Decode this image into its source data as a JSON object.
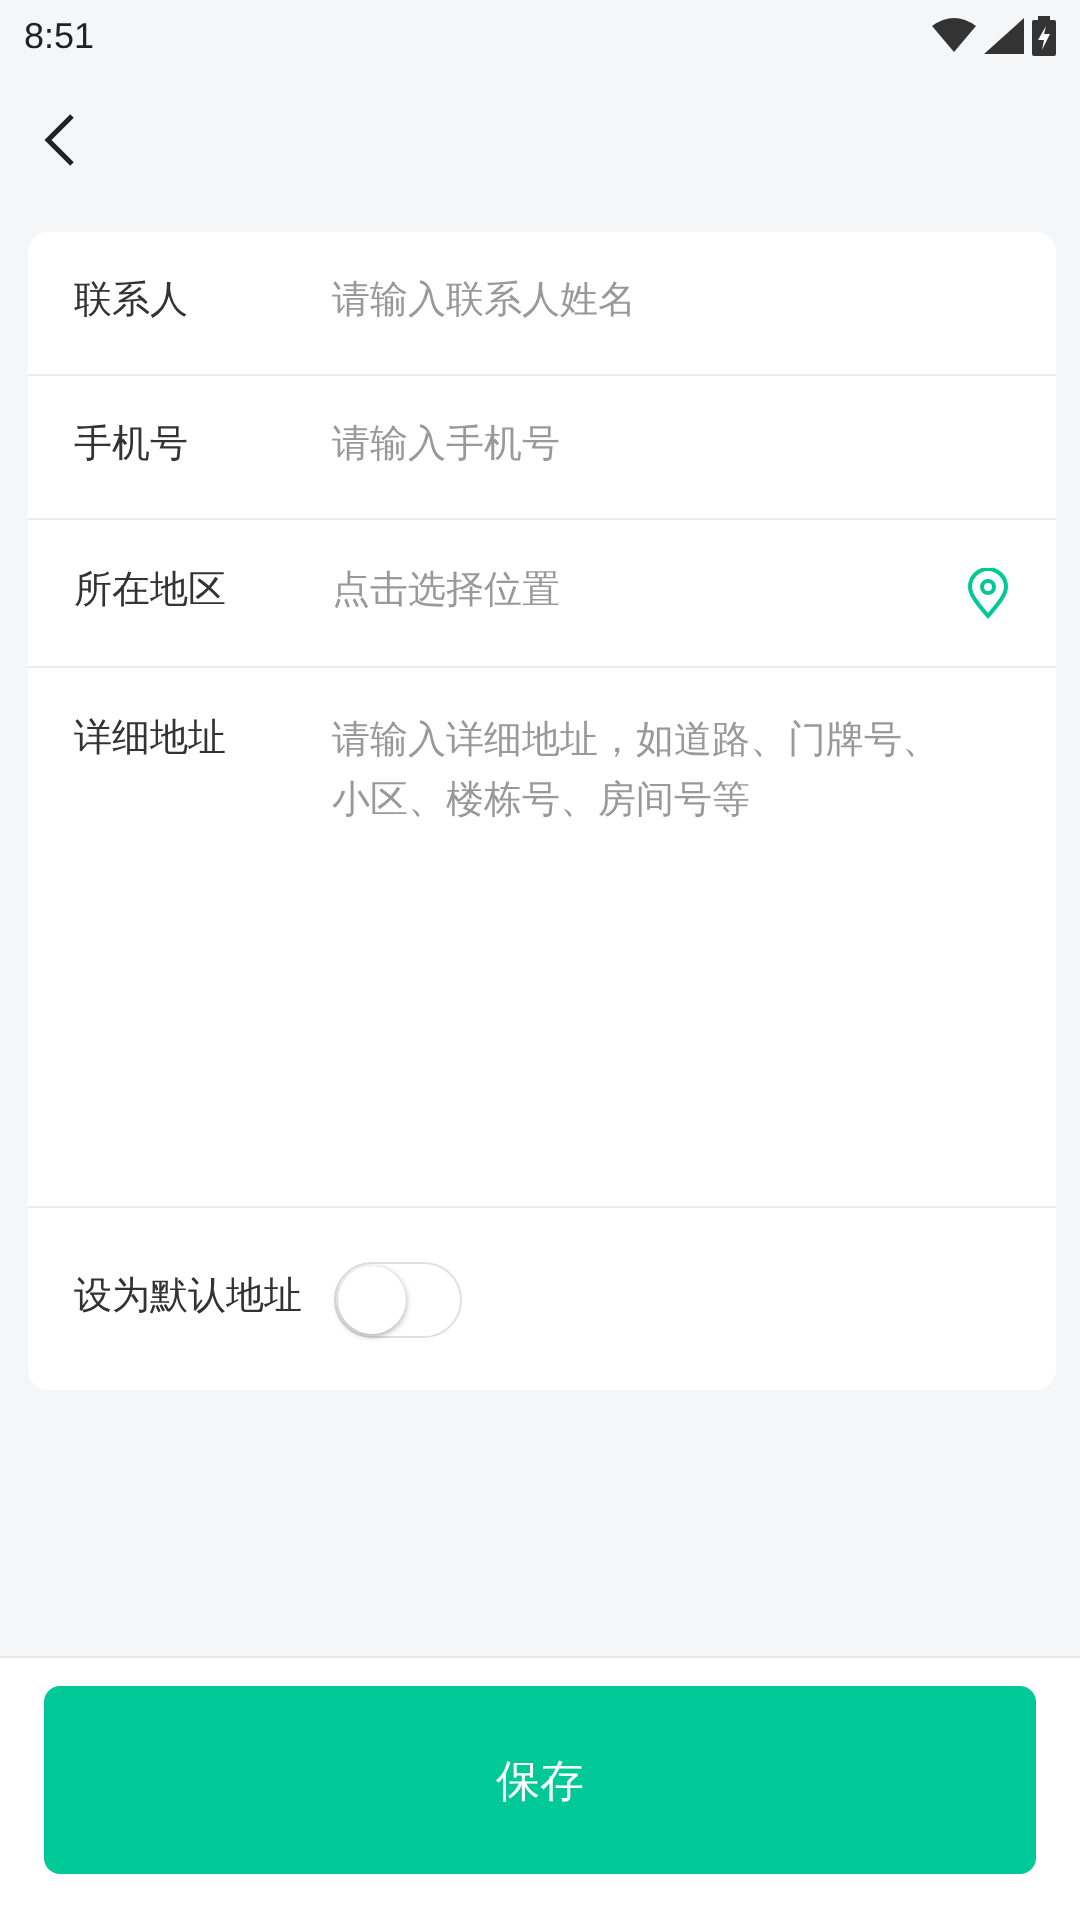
{
  "status_bar": {
    "time": "8:51"
  },
  "form": {
    "rows": [
      {
        "kind": "input",
        "label": "联系人",
        "placeholder": "请输入联系人姓名"
      },
      {
        "kind": "input",
        "label": "手机号",
        "placeholder": "请输入手机号"
      },
      {
        "kind": "location",
        "label": "所在地区",
        "placeholder": "点击选择位置"
      },
      {
        "kind": "textarea",
        "label": "详细地址",
        "placeholder": "请输入详细地址，如道路、门牌号、小区、楼栋号、房间号等"
      }
    ],
    "default_toggle": {
      "label": "设为默认地址",
      "on": false
    }
  },
  "save_button": {
    "label": "保存"
  }
}
